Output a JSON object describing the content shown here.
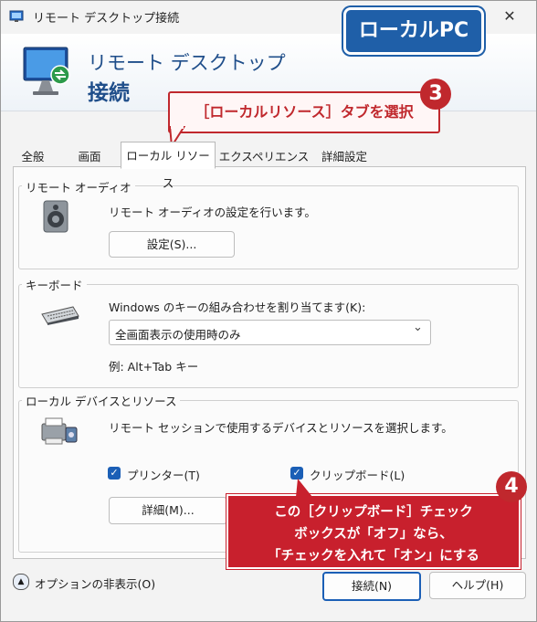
{
  "window": {
    "title": "リモート デスクトップ接続",
    "close_glyph": "✕"
  },
  "banner": {
    "line1": "リモート デスクトップ",
    "line2": "接続"
  },
  "annotations": {
    "local_pc": "ローカルPC",
    "step3_number": "3",
    "step3_text": "［ローカルリソース］タブを選択",
    "step4_number": "4",
    "step4_line1": "この［クリップボード］チェック",
    "step4_line2": "ボックスが「オフ」なら、",
    "step4_line3": "「チェックを入れて「オン」にする"
  },
  "tabs": [
    {
      "label": "全般",
      "selected": false
    },
    {
      "label": "画面",
      "selected": false
    },
    {
      "label": "ローカル リソース",
      "selected": true
    },
    {
      "label": "エクスペリエンス",
      "selected": false
    },
    {
      "label": "詳細設定",
      "selected": false
    }
  ],
  "audio": {
    "group_title": "リモート オーディオ",
    "description": "リモート オーディオの設定を行います。",
    "button": "設定(S)..."
  },
  "keyboard": {
    "group_title": "キーボード",
    "description": "Windows のキーの組み合わせを割り当てます(K):",
    "selected_value": "全画面表示の使用時のみ",
    "example": "例: Alt+Tab キー"
  },
  "devices": {
    "group_title": "ローカル デバイスとリソース",
    "description": "リモート セッションで使用するデバイスとリソースを選択します。",
    "printer_label": "プリンター(T)",
    "printer_checked": true,
    "clipboard_label": "クリップボード(L)",
    "clipboard_checked": true,
    "details_button": "詳細(M)..."
  },
  "footer": {
    "options_label": "オプションの非表示(O)",
    "connect_button": "接続(N)",
    "help_button": "ヘルプ(H)"
  },
  "colors": {
    "accent": "#1b5fb6",
    "callout_red": "#c0282d",
    "banner_text": "#1f4e8a"
  }
}
